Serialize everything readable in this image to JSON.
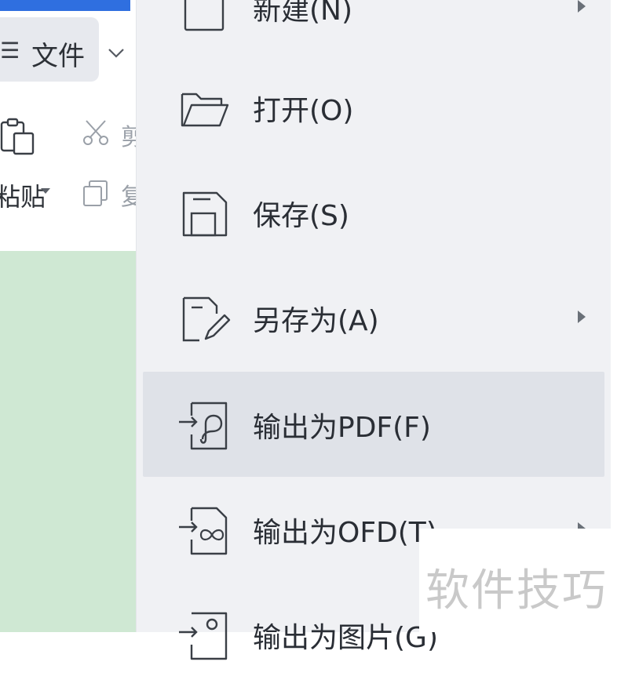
{
  "toolbar": {
    "file_menu_glyph": "☰",
    "file_label": "文件",
    "paste_label": "粘贴",
    "cut_label": "剪",
    "copy_label": "复"
  },
  "menu": {
    "items": [
      {
        "label": "新建(N)",
        "icon": "new-doc-icon",
        "has_submenu": true
      },
      {
        "label": "打开(O)",
        "icon": "folder-open-icon",
        "has_submenu": false
      },
      {
        "label": "保存(S)",
        "icon": "save-icon",
        "has_submenu": false
      },
      {
        "label": "另存为(A)",
        "icon": "save-as-icon",
        "has_submenu": true
      },
      {
        "label": "输出为PDF(F)",
        "icon": "export-pdf-icon",
        "has_submenu": false,
        "highlighted": true
      },
      {
        "label": "输出为OFD(T)",
        "icon": "export-ofd-icon",
        "has_submenu": true
      },
      {
        "label": "输出为图片(G)",
        "icon": "export-image-icon",
        "has_submenu": false
      }
    ]
  },
  "watermark": {
    "text": "软件技巧"
  },
  "colors": {
    "accent": "#2f6fe0",
    "menu_bg": "#f0f1f4",
    "hover_bg": "#dfe2e8",
    "canvas": "#cfe8d3"
  }
}
